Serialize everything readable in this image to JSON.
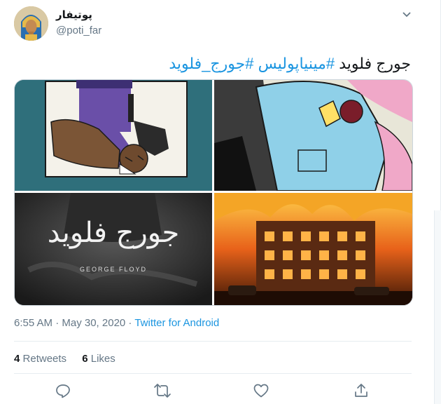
{
  "user": {
    "display_name": "پوتیفار",
    "handle": "@poti_far",
    "avatar_icon": "pharaoh-avatar"
  },
  "tweet": {
    "text_plain": "جورج فلويد",
    "hashtags": [
      "#مینیاپولیس",
      "#جورج_فلويد"
    ]
  },
  "media": {
    "tile3_title_arabic": "جورج فلويد",
    "tile3_caption": "GEORGE FLOYD"
  },
  "meta": {
    "timestamp": "6:55 AM · May 30, 2020",
    "separator": " · ",
    "source": "Twitter for Android"
  },
  "stats": {
    "retweets_count": "4",
    "retweets_label": "Retweets",
    "likes_count": "6",
    "likes_label": "Likes"
  },
  "actions": [
    "reply-icon",
    "retweet-icon",
    "like-icon",
    "share-icon"
  ],
  "colors": {
    "link": "#1b95e0",
    "muted": "#657786",
    "text": "#14171a"
  }
}
